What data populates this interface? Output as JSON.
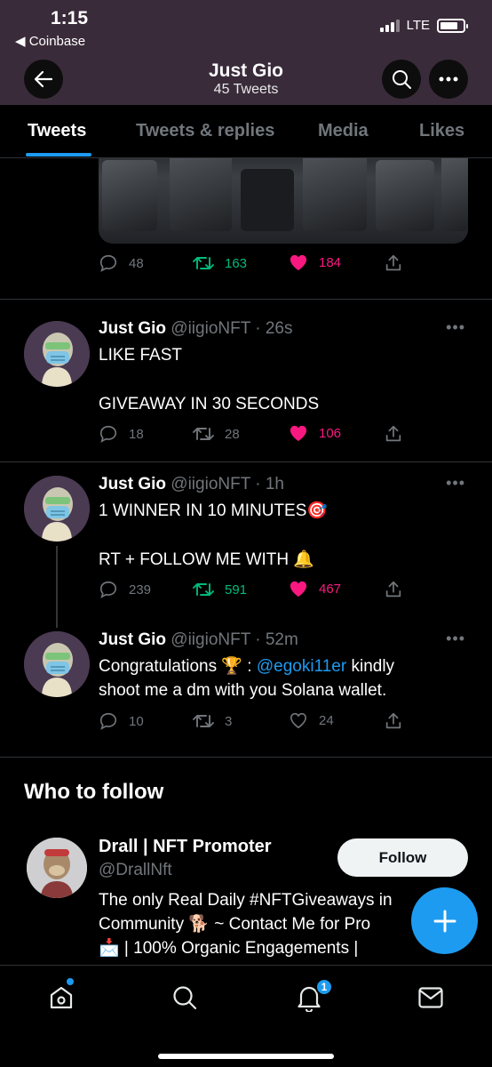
{
  "status": {
    "time": "1:15",
    "back_app": "◀ Coinbase",
    "network": "LTE"
  },
  "header": {
    "title": "Just Gio",
    "subtitle": "45 Tweets"
  },
  "tabs": [
    {
      "label": "Tweets",
      "active": true
    },
    {
      "label": "Tweets & replies",
      "active": false
    },
    {
      "label": "Media",
      "active": false
    },
    {
      "label": "Likes",
      "active": false
    }
  ],
  "tweet0": {
    "replies": "48",
    "retweets": "163",
    "likes": "184"
  },
  "tweets": [
    {
      "name": "Just Gio",
      "handle_time": "@iigioNFT · 26s",
      "line1": "LIKE FAST",
      "line2": "GIVEAWAY IN 30 SECONDS",
      "replies": "18",
      "retweets": "28",
      "likes": "106"
    },
    {
      "name": "Just Gio",
      "handle_time": "@iigioNFT · 1h",
      "line1": "1 WINNER IN 10 MINUTES🎯",
      "line2": "RT + FOLLOW ME WITH 🔔",
      "replies": "239",
      "retweets": "591",
      "likes": "467"
    },
    {
      "name": "Just Gio",
      "handle_time": "@iigioNFT · 52m",
      "line1_a": "Congratulations 🏆 : ",
      "mention": "@egoki11er",
      "line1_b": " kindly",
      "line2": "shoot me a dm with you Solana wallet.",
      "replies": "10",
      "retweets": "3",
      "likes": "24"
    }
  ],
  "who_to_follow": {
    "title": "Who to follow",
    "name": "Drall | NFT Promoter",
    "handle": "@DrallNft",
    "follow_label": "Follow",
    "bio": [
      "The only Real Daily #NFTGiveaways in",
      "Community 🐕 ~ Contact Me for Pro",
      "📩 | 100% Organic Engagements |"
    ]
  },
  "nav": {
    "notifications_badge": "1"
  },
  "colors": {
    "accent": "#1d9bf0",
    "like": "#f91880",
    "retweet": "#00ba7c",
    "header_bg": "#3a2b3a"
  }
}
